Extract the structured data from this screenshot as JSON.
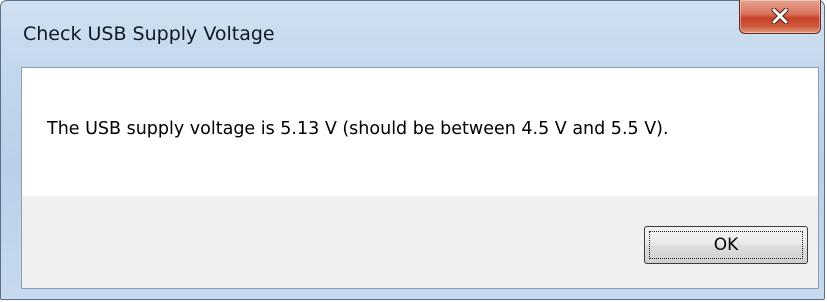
{
  "dialog": {
    "title": "Check USB Supply Voltage",
    "message": "The USB supply voltage is 5.13 V (should be between 4.5 V and 5.5 V).",
    "ok_label": "OK"
  },
  "icons": {
    "close": "close-icon"
  },
  "colors": {
    "titlebar": "#c3d7ec",
    "close_button": "#c7422b",
    "message_background": "#ffffff",
    "button_panel": "#f0f0f0"
  }
}
